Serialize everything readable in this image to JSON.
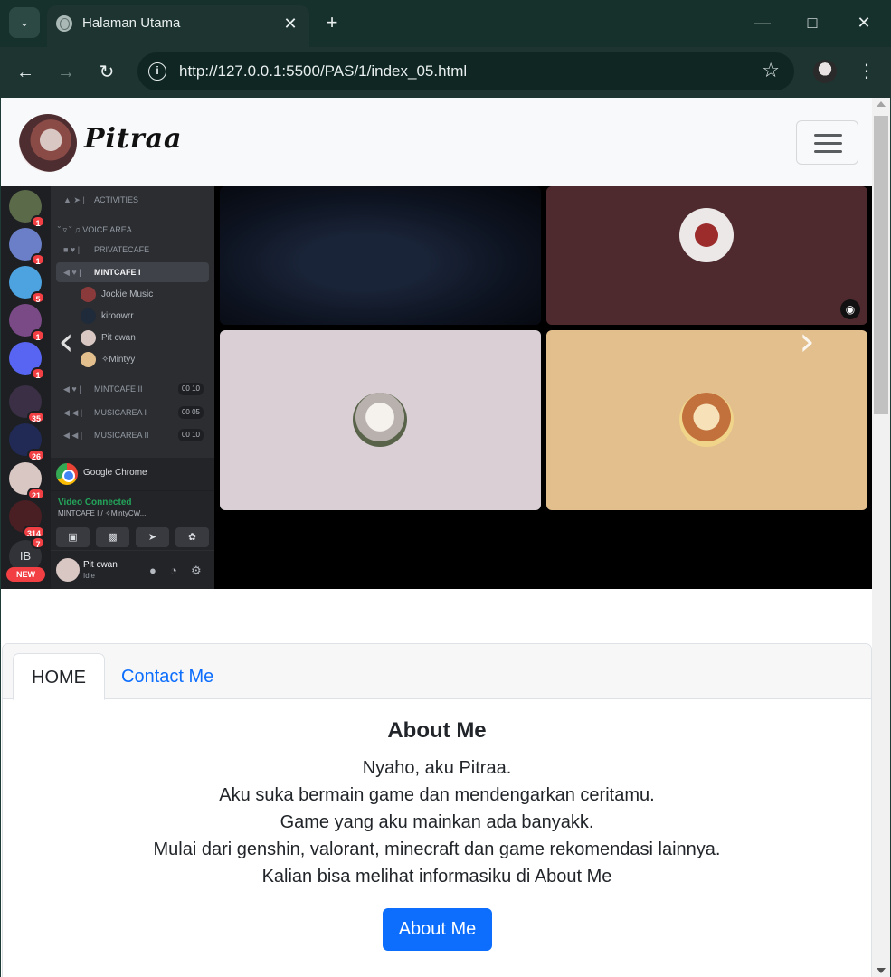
{
  "browser": {
    "tab_title": "Halaman Utama",
    "url": "http://127.0.0.1:5500/PAS/1/index_05.html",
    "icons": [
      "tab-search-icon",
      "globe-icon",
      "close-icon",
      "plus-icon",
      "minimize-icon",
      "maximize-icon",
      "back-icon",
      "forward-icon",
      "reload-icon",
      "site-info-icon",
      "star-icon",
      "profile-avatar",
      "kebab-menu-icon"
    ]
  },
  "navbar": {
    "brand": "Pitraa",
    "toggler_icon": "hamburger-icon"
  },
  "carousel": {
    "slide_screenshot": {
      "server_badges": [
        "1",
        "1",
        "5",
        "1",
        "1",
        "35",
        "26",
        "21",
        "314"
      ],
      "ib_label": "IB",
      "ib_badge": "7",
      "new_badge": "NEW",
      "channels": {
        "activities": "ACTIVITIES",
        "voice_area": "˘ ▿ ˘ ♫ VOICE AREA",
        "privatecafe": "PRIVATECAFE",
        "mintcafe_1": "MINTCAFE I",
        "mintcafe_2": "MINTCAFE II",
        "musicarea_1": "MUSICAREA I",
        "musicarea_2": "MUSICAREA II",
        "count_mintcafe_2": "00 10",
        "count_musicarea_1": "00 05",
        "count_musicarea_2": "00 10"
      },
      "members": [
        "Jockie Music",
        "kiroowrr",
        "Pit cwan",
        "✧Mintyy"
      ],
      "activity_app": "Google Chrome",
      "voice_status": "Video Connected",
      "voice_channel": "MINTCAFE I / ✧MintyCW...",
      "user_name": "Pit cwan",
      "user_state": "Idle"
    },
    "prev_glyph": "‹",
    "next_glyph": "›",
    "colors": {
      "tile_maroon": "#4e2a2e",
      "tile_lavender": "#d9cfd5",
      "tile_sand": "#e2bf8d"
    }
  },
  "tabs": {
    "home": "HOME",
    "contact": "Contact Me"
  },
  "about": {
    "title": "About Me",
    "lines": [
      "Nyaho, aku Pitraa.",
      "Aku suka bermain game dan mendengarkan ceritamu.",
      "Game yang aku mainkan ada banyakk.",
      "Mulai dari genshin, valorant, minecraft dan game rekomendasi lainnya.",
      "Kalian bisa melihat informasiku di About Me"
    ],
    "button": "About Me"
  },
  "colors": {
    "primary": "#0d6efd",
    "chrome_bg": "#1d3430",
    "navbar_bg": "#f8f9fa"
  }
}
